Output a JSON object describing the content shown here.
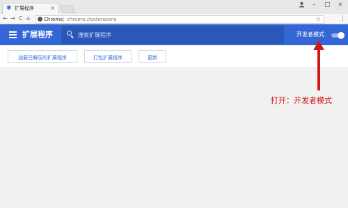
{
  "browser": {
    "tab_title": "扩展程序",
    "tab_close": "×",
    "window_controls": {
      "user_icon": "user-icon",
      "minimize": "–",
      "maximize": "□",
      "close": "×"
    },
    "nav": {
      "back": "←",
      "forward": "→",
      "reload": "C",
      "home": "⌂"
    },
    "site_label": "Chrome",
    "url": "chrome://extensions",
    "star": "☆",
    "menu": "⋮"
  },
  "toolbar": {
    "title": "扩展程序",
    "search_placeholder": "搜索扩展程序",
    "developer_mode_label": "开发者模式",
    "developer_mode_on": true
  },
  "actions": {
    "load_unpacked": "加载已解压的扩展程序",
    "pack_extension": "打包扩展程序",
    "update": "更新"
  },
  "annotation": {
    "text": "打开：开发者模式",
    "color": "#d01818"
  },
  "colors": {
    "toolbar": "#3367d6",
    "accent": "#3367d6",
    "annotation": "#d01818"
  }
}
